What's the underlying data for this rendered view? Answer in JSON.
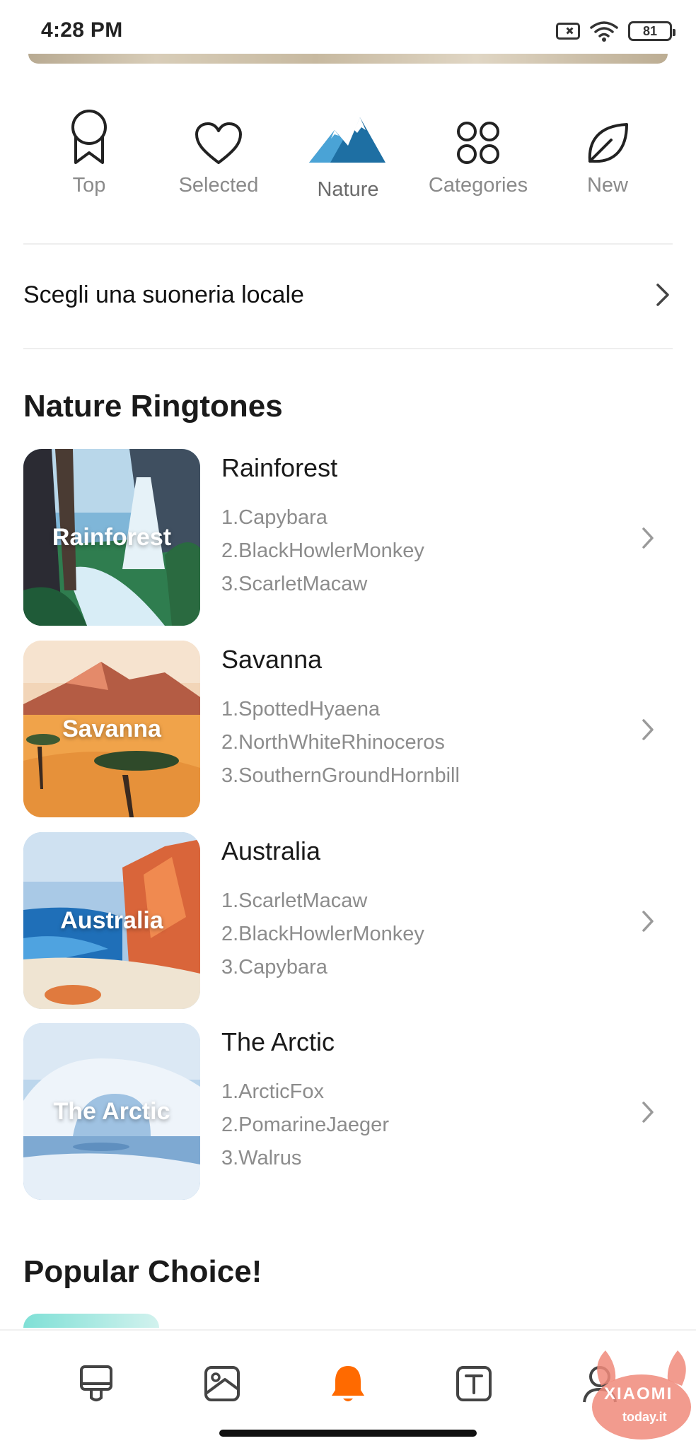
{
  "status_bar": {
    "time": "4:28 PM",
    "battery": "81"
  },
  "categories": [
    {
      "label": "Top",
      "icon": "ribbon-icon"
    },
    {
      "label": "Selected",
      "icon": "heart-icon"
    },
    {
      "label": "Nature",
      "icon": "mountain-icon",
      "active": true
    },
    {
      "label": "Categories",
      "icon": "grid-icon"
    },
    {
      "label": "New",
      "icon": "leaf-icon"
    }
  ],
  "local_ringtone": {
    "label": "Scegli una suoneria locale"
  },
  "nature_section": {
    "title": "Nature Ringtones",
    "items": [
      {
        "thumb_label": "Rainforest",
        "title": "Rainforest",
        "tracks": [
          "1.Capybara",
          "2.BlackHowlerMonkey",
          "3.ScarletMacaw"
        ]
      },
      {
        "thumb_label": "Savanna",
        "title": "Savanna",
        "tracks": [
          "1.SpottedHyaena",
          "2.NorthWhiteRhinoceros",
          "3.SouthernGroundHornbill"
        ]
      },
      {
        "thumb_label": "Australia",
        "title": "Australia",
        "tracks": [
          "1.ScarletMacaw",
          "2.BlackHowlerMonkey",
          "3.Capybara"
        ]
      },
      {
        "thumb_label": "The Arctic",
        "title": "The Arctic",
        "tracks": [
          "1.ArcticFox",
          "2.PomarineJaeger",
          "3.Walrus"
        ]
      }
    ]
  },
  "popular_section": {
    "title": "Popular Choice!"
  },
  "bottom_nav": [
    {
      "icon": "themes-icon"
    },
    {
      "icon": "wallpaper-icon"
    },
    {
      "icon": "bell-icon",
      "active": true
    },
    {
      "icon": "fonts-icon"
    },
    {
      "icon": "profile-icon"
    }
  ],
  "watermark": {
    "brand": "XIAOMI",
    "site": "today.it"
  },
  "colors": {
    "accent": "#ff6a00",
    "mountain": "#1e6fa3",
    "muted_text": "#8c8c8c"
  }
}
